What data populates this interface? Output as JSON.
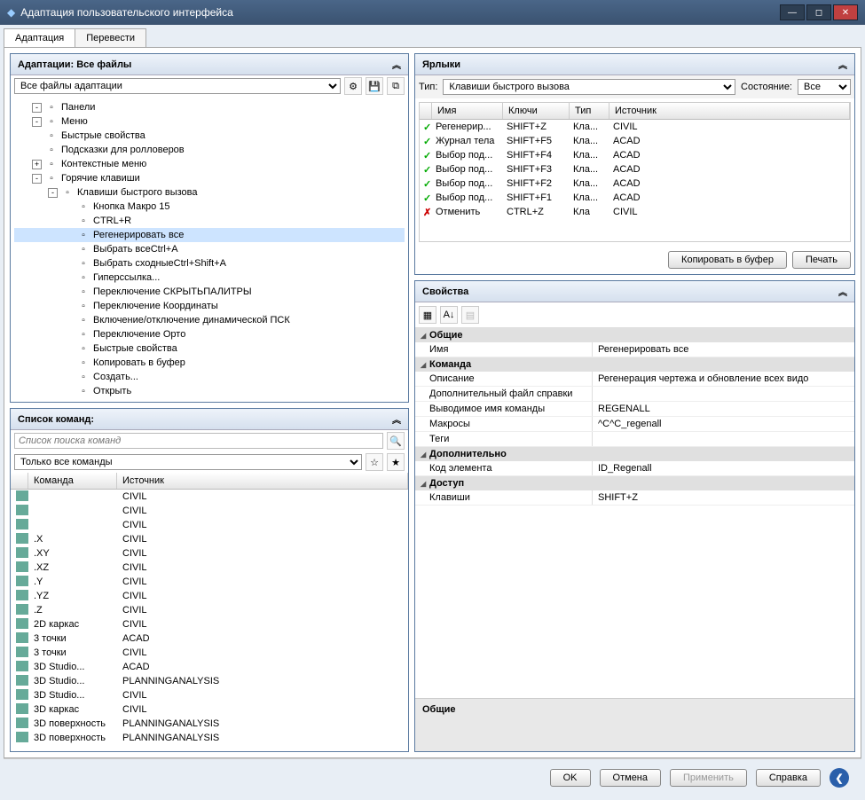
{
  "title": "Адаптация пользовательского интерфейса",
  "tabs": [
    "Адаптация",
    "Перевести"
  ],
  "adaptations": {
    "header": "Адаптации: Все файлы",
    "dropdown": "Все файлы адаптации",
    "tree": [
      {
        "d": 0,
        "e": "-",
        "t": "Панели"
      },
      {
        "d": 0,
        "e": "-",
        "t": "Меню"
      },
      {
        "d": 0,
        "e": " ",
        "t": "Быстрые свойства"
      },
      {
        "d": 0,
        "e": " ",
        "t": "Подсказки для ролловеров"
      },
      {
        "d": 0,
        "e": "+",
        "t": "Контекстные меню"
      },
      {
        "d": 0,
        "e": "-",
        "t": "Горячие клавиши"
      },
      {
        "d": 1,
        "e": "-",
        "t": "Клавиши быстрого вызова"
      },
      {
        "d": 2,
        "e": " ",
        "t": "Кнопка Макро 15"
      },
      {
        "d": 2,
        "e": " ",
        "t": "CTRL+R"
      },
      {
        "d": 2,
        "e": " ",
        "t": "Регенерировать все",
        "sel": true
      },
      {
        "d": 2,
        "e": " ",
        "t": "Выбрать всеCtrl+A"
      },
      {
        "d": 2,
        "e": " ",
        "t": "Выбрать сходныеCtrl+Shift+A"
      },
      {
        "d": 2,
        "e": " ",
        "t": "Гиперссылка..."
      },
      {
        "d": 2,
        "e": " ",
        "t": "Переключение СКРЫТЬПАЛИТРЫ"
      },
      {
        "d": 2,
        "e": " ",
        "t": "Переключение Координаты"
      },
      {
        "d": 2,
        "e": " ",
        "t": "Включение/отключение динамической ПСК"
      },
      {
        "d": 2,
        "e": " ",
        "t": "Переключение Орто"
      },
      {
        "d": 2,
        "e": " ",
        "t": "Быстрые свойства"
      },
      {
        "d": 2,
        "e": " ",
        "t": "Копировать в буфер"
      },
      {
        "d": 2,
        "e": " ",
        "t": "Создать..."
      },
      {
        "d": 2,
        "e": " ",
        "t": "Открыть"
      }
    ]
  },
  "cmdlist": {
    "header": "Список команд:",
    "search_ph": "Список поиска команд",
    "filter": "Только все команды",
    "cols": [
      "Команда",
      "Источник"
    ],
    "rows": [
      {
        "c": "",
        "s": "CIVIL"
      },
      {
        "c": "",
        "s": "CIVIL"
      },
      {
        "c": "",
        "s": "CIVIL"
      },
      {
        "c": ".X",
        "s": "CIVIL"
      },
      {
        "c": ".XY",
        "s": "CIVIL"
      },
      {
        "c": ".XZ",
        "s": "CIVIL"
      },
      {
        "c": ".Y",
        "s": "CIVIL"
      },
      {
        "c": ".YZ",
        "s": "CIVIL"
      },
      {
        "c": ".Z",
        "s": "CIVIL"
      },
      {
        "c": "2D каркас",
        "s": "CIVIL"
      },
      {
        "c": "3 точки",
        "s": "ACAD"
      },
      {
        "c": "3 точки",
        "s": "CIVIL"
      },
      {
        "c": "3D Studio...",
        "s": "ACAD"
      },
      {
        "c": "3D Studio...",
        "s": "PLANNINGANALYSIS"
      },
      {
        "c": "3D Studio...",
        "s": "CIVIL"
      },
      {
        "c": "3D каркас",
        "s": "CIVIL"
      },
      {
        "c": "3D поверхность",
        "s": "PLANNINGANALYSIS"
      },
      {
        "c": "3D поверхность",
        "s": "PLANNINGANALYSIS"
      }
    ]
  },
  "shortcuts": {
    "header": "Ярлыки",
    "type_lbl": "Тип:",
    "type_val": "Клавиши быстрого вызова",
    "state_lbl": "Состояние:",
    "state_val": "Все",
    "cols": [
      "Имя",
      "Ключи",
      "Тип",
      "Источник"
    ],
    "rows": [
      {
        "ok": true,
        "n": "Регенерир...",
        "k": "SHIFT+Z",
        "t": "Кла...",
        "s": "CIVIL"
      },
      {
        "ok": true,
        "n": "Журнал тела",
        "k": "SHIFT+F5",
        "t": "Кла...",
        "s": "ACAD"
      },
      {
        "ok": true,
        "n": "Выбор под...",
        "k": "SHIFT+F4",
        "t": "Кла...",
        "s": "ACAD"
      },
      {
        "ok": true,
        "n": "Выбор под...",
        "k": "SHIFT+F3",
        "t": "Кла...",
        "s": "ACAD"
      },
      {
        "ok": true,
        "n": "Выбор под...",
        "k": "SHIFT+F2",
        "t": "Кла...",
        "s": "ACAD"
      },
      {
        "ok": true,
        "n": "Выбор под...",
        "k": "SHIFT+F1",
        "t": "Кла...",
        "s": "ACAD"
      },
      {
        "ok": false,
        "n": "Отменить",
        "k": "CTRL+Z",
        "t": "Кла",
        "s": "CIVIL"
      }
    ],
    "copy_btn": "Копировать в буфер",
    "print_btn": "Печать"
  },
  "props": {
    "header": "Свойства",
    "cats": [
      {
        "name": "Общие",
        "rows": [
          {
            "n": "Имя",
            "v": "Регенерировать все"
          }
        ]
      },
      {
        "name": "Команда",
        "rows": [
          {
            "n": "Описание",
            "v": "Регенерация чертежа и обновление всех видо"
          },
          {
            "n": "Дополнительный файл справки",
            "v": ""
          },
          {
            "n": "Выводимое имя команды",
            "v": "REGENALL"
          },
          {
            "n": "Макросы",
            "v": "^C^C_regenall"
          },
          {
            "n": "Теги",
            "v": ""
          }
        ]
      },
      {
        "name": "Дополнительно",
        "rows": [
          {
            "n": "Код элемента",
            "v": "ID_Regenall"
          }
        ]
      },
      {
        "name": "Доступ",
        "rows": [
          {
            "n": "Клавиши",
            "v": "SHIFT+Z"
          }
        ]
      }
    ],
    "footer": "Общие"
  },
  "footer": {
    "ok": "OK",
    "cancel": "Отмена",
    "apply": "Применить",
    "help": "Справка"
  }
}
